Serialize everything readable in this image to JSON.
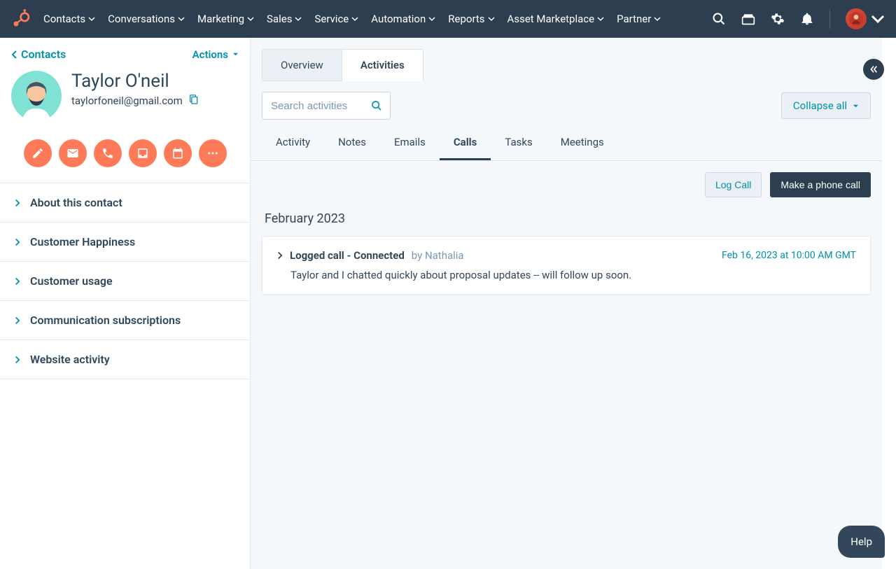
{
  "topnav": {
    "items": [
      {
        "label": "Contacts"
      },
      {
        "label": "Conversations"
      },
      {
        "label": "Marketing"
      },
      {
        "label": "Sales"
      },
      {
        "label": "Service"
      },
      {
        "label": "Automation"
      },
      {
        "label": "Reports"
      },
      {
        "label": "Asset Marketplace"
      },
      {
        "label": "Partner"
      }
    ]
  },
  "sidebar": {
    "back_label": "Contacts",
    "actions_label": "Actions",
    "contact_name": "Taylor O'neil",
    "contact_email": "taylorfoneil@gmail.com",
    "sections": [
      {
        "label": "About this contact"
      },
      {
        "label": "Customer Happiness"
      },
      {
        "label": "Customer usage"
      },
      {
        "label": "Communication subscriptions"
      },
      {
        "label": "Website activity"
      }
    ]
  },
  "main": {
    "tabs": [
      {
        "label": "Overview",
        "active": false
      },
      {
        "label": "Activities",
        "active": true
      }
    ],
    "search_placeholder": "Search activities",
    "collapse_label": "Collapse all",
    "subtabs": [
      {
        "label": "Activity"
      },
      {
        "label": "Notes"
      },
      {
        "label": "Emails"
      },
      {
        "label": "Calls",
        "active": true
      },
      {
        "label": "Tasks"
      },
      {
        "label": "Meetings"
      }
    ],
    "log_call_label": "Log Call",
    "make_call_label": "Make a phone call",
    "month_header": "February 2023",
    "call_card": {
      "title": "Logged call - Connected",
      "by_label": "by Nathalia",
      "timestamp": "Feb 16, 2023 at 10:00 AM GMT",
      "body": "Taylor and I chatted quickly about proposal updates -- will follow up soon."
    }
  },
  "help_label": "Help"
}
